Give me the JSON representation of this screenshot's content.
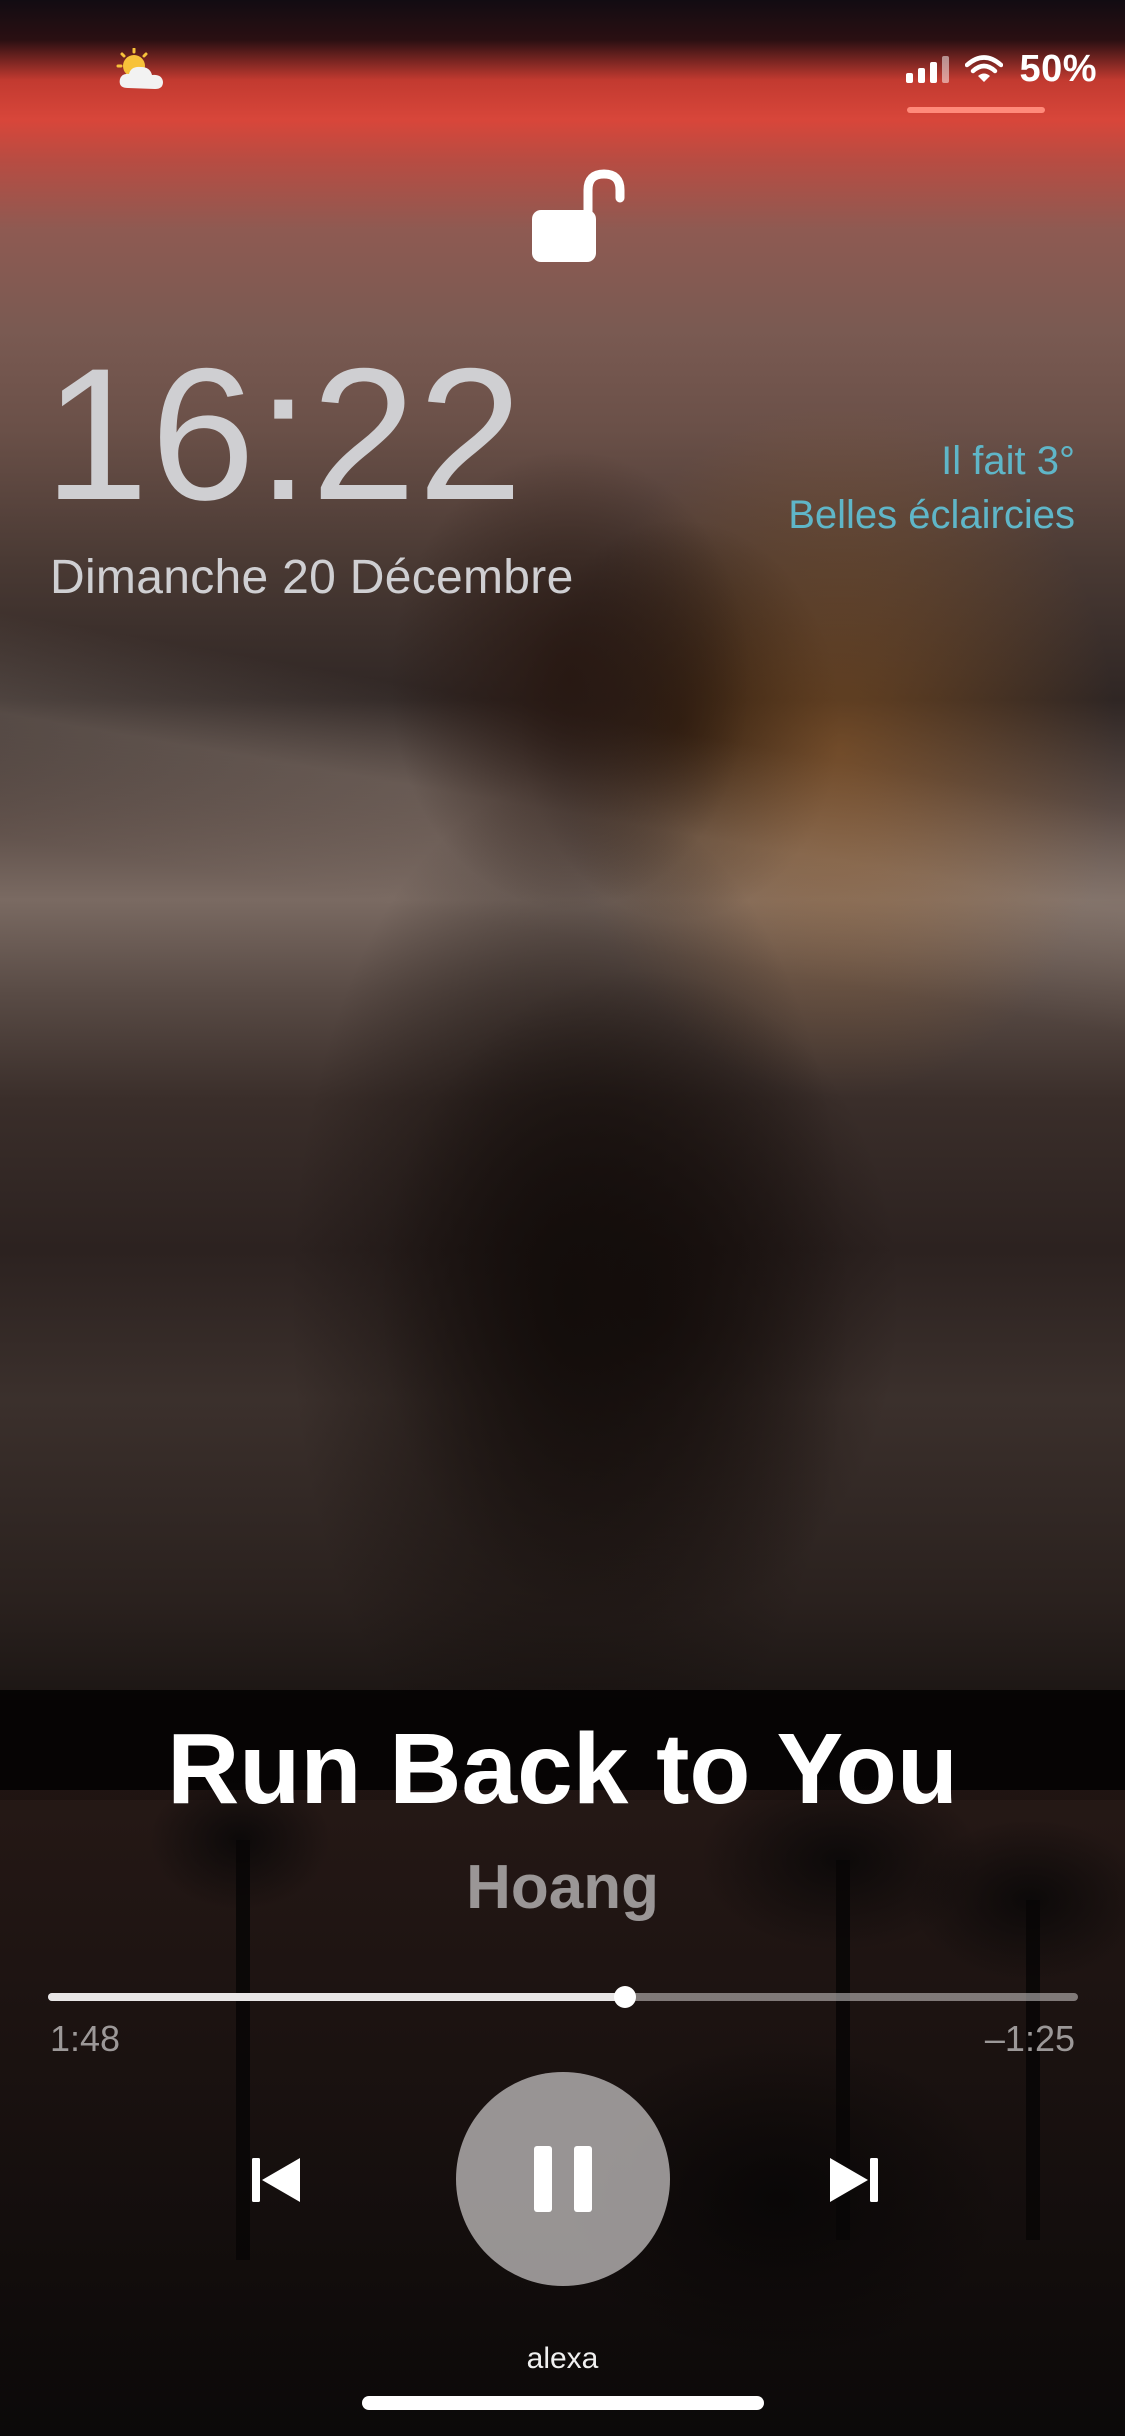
{
  "status_bar": {
    "weather_icon": "partly-cloudy-icon",
    "signal_icon": "cellular-signal-icon",
    "wifi_icon": "wifi-icon",
    "battery_percent": "50%"
  },
  "lock": {
    "icon": "unlocked-padlock-icon"
  },
  "clock": {
    "time": "16:22",
    "date": "Dimanche 20 Décembre"
  },
  "weather": {
    "line1": "Il fait 3°",
    "line2": "Belles éclaircies",
    "color": "#5fb6c8"
  },
  "now_playing": {
    "title": "Run Back to You",
    "artist": "Hoang",
    "elapsed": "1:48",
    "remaining": "–1:25",
    "progress_fraction": 0.56,
    "controls": {
      "previous_icon": "skip-previous-icon",
      "pause_icon": "pause-icon",
      "next_icon": "skip-next-icon"
    },
    "output_device": "alexa"
  },
  "colors": {
    "status_underline": "#ff8a7a",
    "text_primary": "#ffffff",
    "text_secondary": "#9a9696"
  }
}
